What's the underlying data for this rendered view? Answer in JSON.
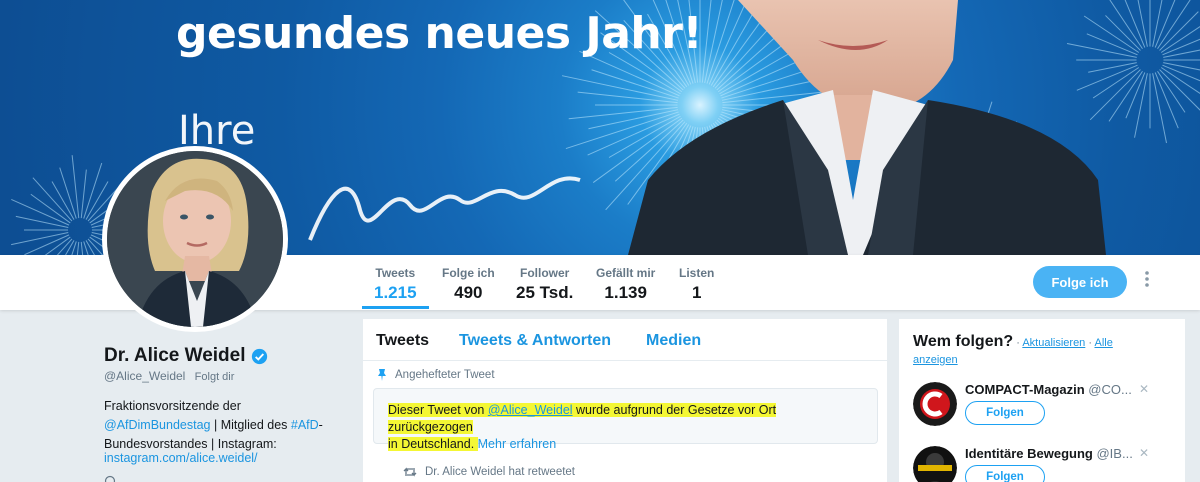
{
  "banner": {
    "headline": "gesundes neues Jahr!",
    "subline": "Ihre"
  },
  "nav": {
    "stats": [
      {
        "label": "Tweets",
        "value": "1.215"
      },
      {
        "label": "Folge ich",
        "value": "490"
      },
      {
        "label": "Follower",
        "value": "25 Tsd."
      },
      {
        "label": "Gefällt mir",
        "value": "1.139"
      },
      {
        "label": "Listen",
        "value": "1"
      }
    ],
    "follow_button": "Folge ich",
    "more_icon": "vertical-dots-icon"
  },
  "profile": {
    "name": "Dr. Alice Weidel",
    "handle": "@Alice_Weidel",
    "follows_you": "Folgt dir",
    "bio_1": "Fraktionsvorsitzende der",
    "bio_mention": "@AfDimBundestag",
    "bio_2": " | Mitglied des ",
    "bio_hashtag": "#AfD",
    "bio_3": "-Bundesvorstandes | Instagram:",
    "link": "instagram.com/alice.weidel/",
    "accent_color": "#1da1f2"
  },
  "timeline": {
    "tabs": [
      "Tweets",
      "Tweets & Antworten",
      "Medien"
    ],
    "pinned_label": "Angehefteter Tweet",
    "notice_1": "Dieser Tweet von ",
    "notice_handle": "@Alice_Weidel",
    "notice_2": " wurde aufgrund der Gesetze vor Ort zurückgezogen",
    "notice_3": "in Deutschland. ",
    "notice_link": "Mehr erfahren",
    "retweet_label": "Dr. Alice Weidel hat retweetet"
  },
  "who_to_follow": {
    "title": "Wem folgen?",
    "sep": " · ",
    "refresh": "Aktualisieren",
    "show_all": "Alle anzeigen",
    "suggestions": [
      {
        "name": "COMPACT-Magazin",
        "handle": "@CO...",
        "button": "Folgen"
      },
      {
        "name": "Identitäre Bewegung",
        "handle": "@IB...",
        "button": "Folgen"
      }
    ]
  }
}
